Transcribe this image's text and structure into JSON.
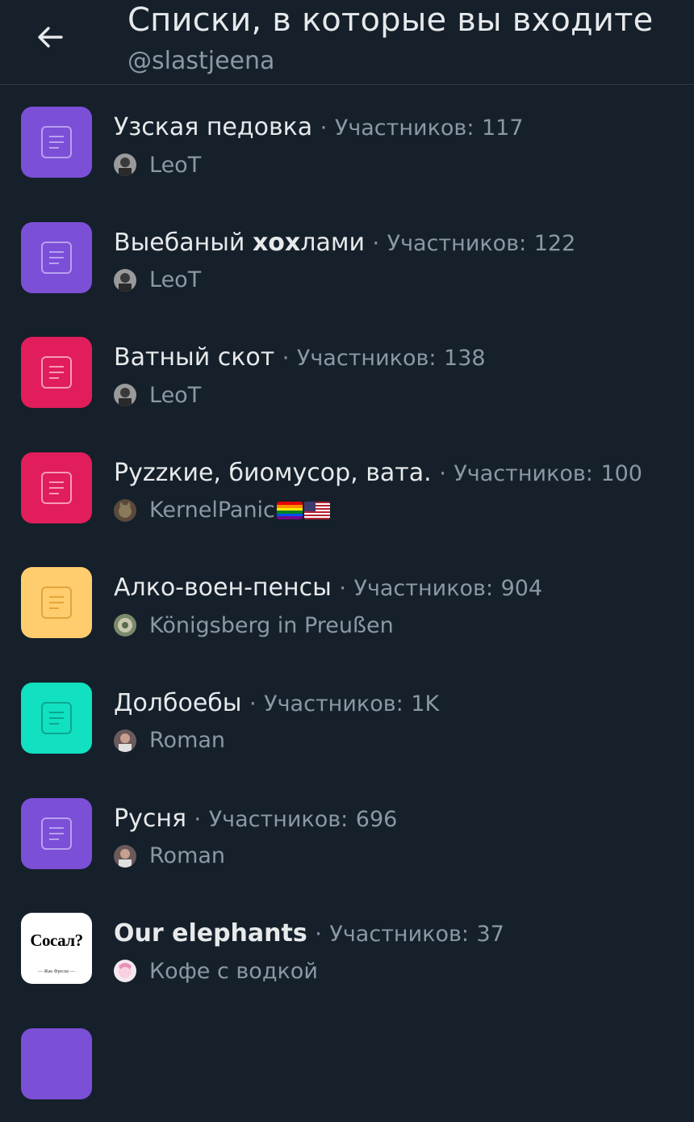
{
  "header": {
    "title": "Списки, в которые вы входите",
    "subtitle": "@slastjeena",
    "back_icon": "arrow-left-icon"
  },
  "colors": {
    "background": "#15202b",
    "purple": "#7b4fd6",
    "red": "#e11d5b",
    "yellow": "#ffcd6e",
    "teal": "#11e0c1",
    "secondary_text": "#8b98a5"
  },
  "count_label": "Участников:",
  "separator": "·",
  "lists": [
    {
      "name": "Узская педовка",
      "count": "117",
      "owner": "LeoT",
      "icon_color": "purple",
      "avatar": "grey-portrait"
    },
    {
      "name_plain": "Выебаный ",
      "name_bold": "хох",
      "name_rest": "лами",
      "count": "122",
      "owner": "LeoT",
      "icon_color": "purple",
      "avatar": "grey-portrait"
    },
    {
      "name": "Ватный скот",
      "count": "138",
      "owner": "LeoT",
      "icon_color": "red",
      "avatar": "grey-portrait"
    },
    {
      "name": "Руzzкие, биомусор, вата.",
      "count": "100",
      "owner": "KernelPanic",
      "owner_flags": "rainbow-flag, us-flag",
      "icon_color": "red",
      "avatar": "cat"
    },
    {
      "name": "Алко-воен-пенсы",
      "count": "904",
      "owner": "Königsberg in Preußen",
      "icon_color": "yellow",
      "avatar": "crest"
    },
    {
      "name": "Долбоебы",
      "count": "1K",
      "owner": "Roman",
      "icon_color": "teal",
      "avatar": "portrait"
    },
    {
      "name": "Русня",
      "count": "696",
      "owner": "Roman",
      "icon_color": "purple",
      "avatar": "portrait"
    },
    {
      "name": "Our elephants",
      "count": "37",
      "owner": "Кофе с водкой",
      "icon_color": "image",
      "icon_text": "Сосал?",
      "icon_subtext": "— Жак Фреско —",
      "avatar": "pony"
    }
  ]
}
